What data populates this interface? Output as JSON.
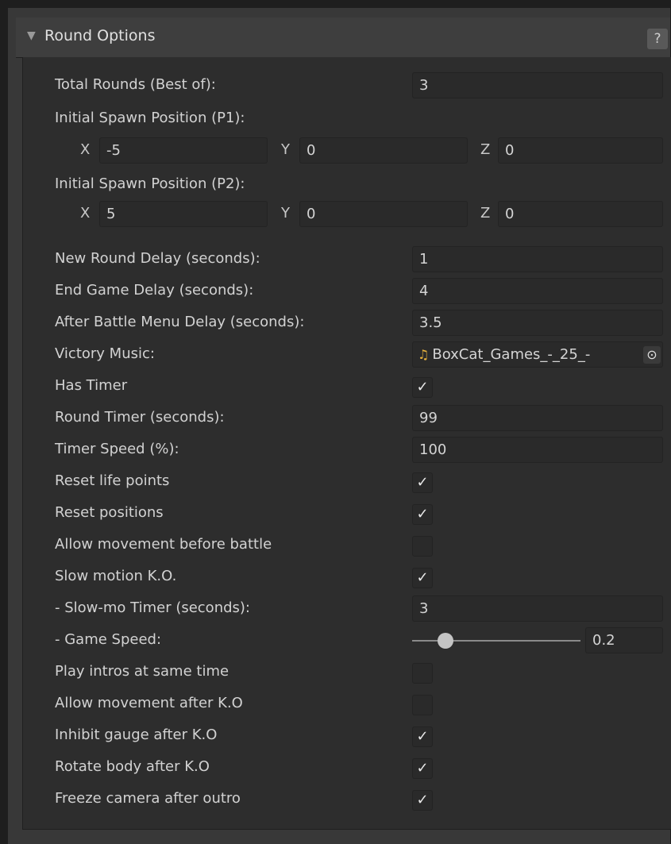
{
  "section": {
    "title": "Round Options",
    "help": "?"
  },
  "rows": {
    "total_rounds": {
      "label": "Total Rounds (Best of):",
      "value": "3"
    },
    "spawn_p1": {
      "label": "Initial Spawn Position (P1):",
      "x": "-5",
      "y": "0",
      "z": "0"
    },
    "spawn_p2": {
      "label": "Initial Spawn Position (P2):",
      "x": "5",
      "y": "0",
      "z": "0"
    },
    "axis": {
      "x": "X",
      "y": "Y",
      "z": "Z"
    },
    "new_round_delay": {
      "label": "New Round Delay (seconds):",
      "value": "1"
    },
    "end_game_delay": {
      "label": "End Game Delay (seconds):",
      "value": "4"
    },
    "after_battle_delay": {
      "label": "After Battle Menu Delay (seconds):",
      "value": "3.5"
    },
    "victory_music": {
      "label": "Victory Music:",
      "value": "BoxCat_Games_-_25_-"
    },
    "has_timer": {
      "label": "Has Timer",
      "checked": true
    },
    "round_timer": {
      "label": "Round Timer (seconds):",
      "value": "99"
    },
    "timer_speed": {
      "label": "Timer Speed (%):",
      "value": "100"
    },
    "reset_life": {
      "label": "Reset life points",
      "checked": true
    },
    "reset_positions": {
      "label": "Reset positions",
      "checked": true
    },
    "allow_move_before": {
      "label": "Allow movement before battle",
      "checked": false
    },
    "slow_motion_ko": {
      "label": "Slow motion K.O.",
      "checked": true
    },
    "slowmo_timer": {
      "label": "- Slow-mo Timer (seconds):",
      "value": "3"
    },
    "game_speed": {
      "label": "- Game Speed:",
      "value": "0.2",
      "fraction": 0.2
    },
    "play_intros": {
      "label": "Play intros at same time",
      "checked": false
    },
    "allow_move_after_ko": {
      "label": "Allow movement after K.O",
      "checked": false
    },
    "inhibit_gauge": {
      "label": "Inhibit gauge after K.O",
      "checked": true
    },
    "rotate_body": {
      "label": "Rotate body after K.O",
      "checked": true
    },
    "freeze_camera": {
      "label": "Freeze camera after outro",
      "checked": true
    }
  },
  "icons": {
    "check": "✓",
    "music": "♫",
    "picker": "⊙",
    "foldout": "▼"
  }
}
